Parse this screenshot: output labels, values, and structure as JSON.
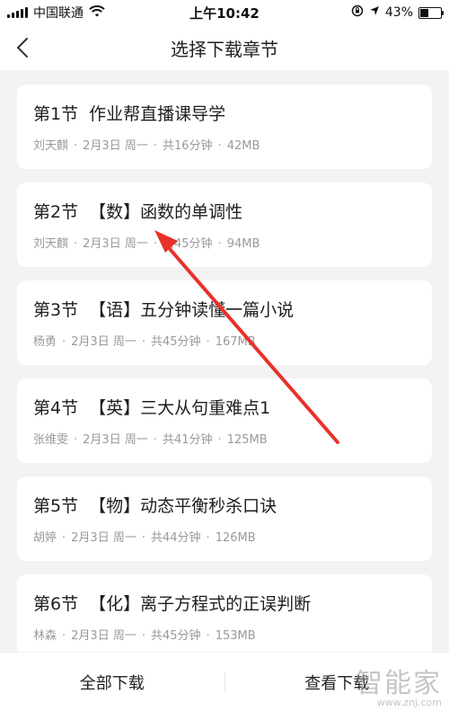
{
  "status_bar": {
    "carrier": "中国联通",
    "time": "上午10:42",
    "battery_percent": "43%",
    "battery_level": 0.43
  },
  "header": {
    "title": "选择下载章节",
    "back_icon": "chevron-left-icon"
  },
  "chapters": [
    {
      "num": "第1节",
      "title": "作业帮直播课导学",
      "teacher": "刘天麒",
      "date": "2月3日",
      "weekday": "周一",
      "duration": "共16分钟",
      "size": "42MB"
    },
    {
      "num": "第2节",
      "title": "【数】函数的单调性",
      "teacher": "刘天麒",
      "date": "2月3日",
      "weekday": "周一",
      "duration": "共45分钟",
      "size": "94MB"
    },
    {
      "num": "第3节",
      "title": "【语】五分钟读懂一篇小说",
      "teacher": "杨勇",
      "date": "2月3日",
      "weekday": "周一",
      "duration": "共45分钟",
      "size": "167MB"
    },
    {
      "num": "第4节",
      "title": "【英】三大从句重难点1",
      "teacher": "张维雯",
      "date": "2月3日",
      "weekday": "周一",
      "duration": "共41分钟",
      "size": "125MB"
    },
    {
      "num": "第5节",
      "title": "【物】动态平衡秒杀口诀",
      "teacher": "胡婷",
      "date": "2月3日",
      "weekday": "周一",
      "duration": "共44分钟",
      "size": "126MB"
    },
    {
      "num": "第6节",
      "title": "【化】离子方程式的正误判断",
      "teacher": "林森",
      "date": "2月3日",
      "weekday": "周一",
      "duration": "共45分钟",
      "size": "153MB"
    }
  ],
  "bottom_bar": {
    "download_all": "全部下载",
    "view_downloads": "查看下载"
  },
  "watermark": {
    "brand": "智能家",
    "url": "www.znj.com"
  },
  "colors": {
    "annotation_arrow": "#e8312a",
    "background": "#f3f3f3"
  }
}
